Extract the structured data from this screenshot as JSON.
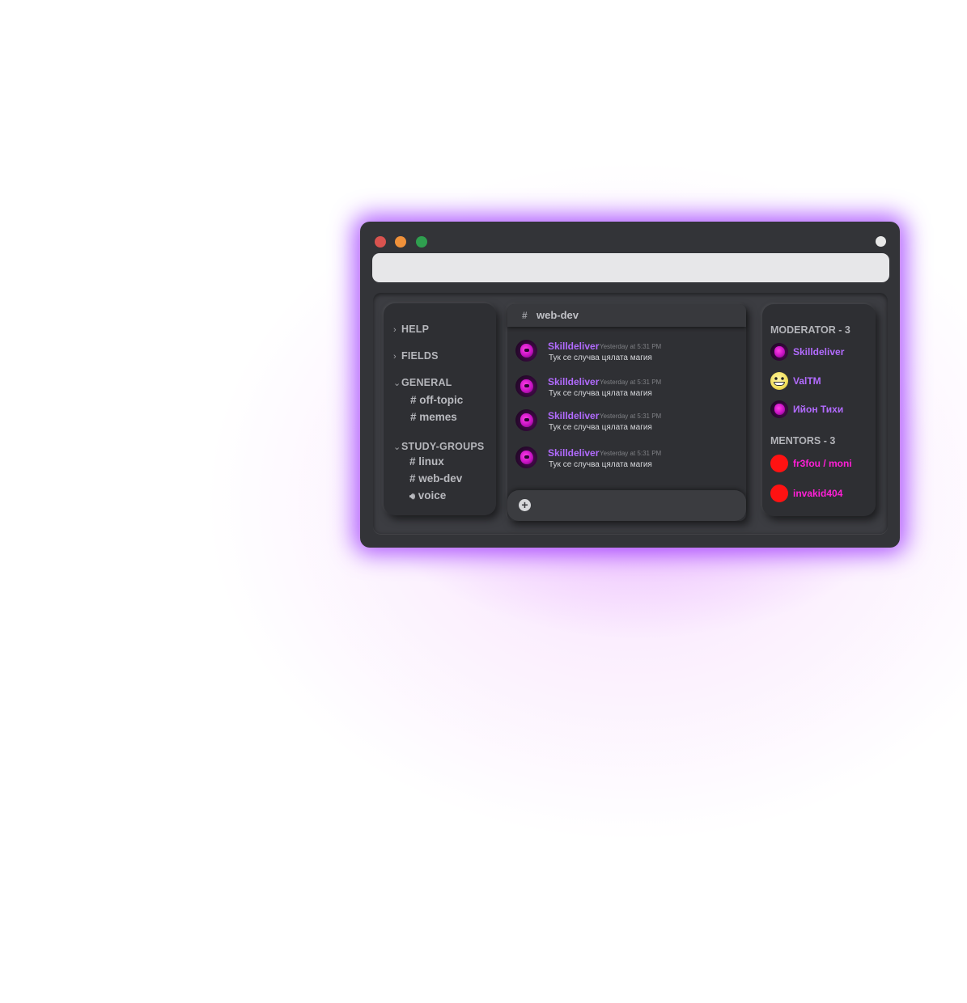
{
  "window": {
    "controls": [
      "close",
      "minimize",
      "maximize"
    ]
  },
  "address_bar": {
    "value": ""
  },
  "channels": {
    "categories": [
      {
        "label": "HELP",
        "expanded": false
      },
      {
        "label": "FIELDS",
        "expanded": false
      },
      {
        "label": "GENERAL",
        "expanded": true,
        "items": [
          "# off-topic",
          "# memes"
        ]
      },
      {
        "label": "STUDY-GROUPS",
        "expanded": true,
        "items": [
          "# linux",
          "# web-dev",
          "voice"
        ]
      }
    ]
  },
  "chat": {
    "hash": "#",
    "channel": "web-dev",
    "messages": [
      {
        "author": "Skilldeliver",
        "time": "Yesterday at 5:31 PM",
        "text": "Тук се случва цялата магия"
      },
      {
        "author": "Skilldeliver",
        "time": "Yesterday at 5:31 PM",
        "text": "Тук се случва цялата магия"
      },
      {
        "author": "Skilldeliver",
        "time": "Yesterday at 5:31 PM",
        "text": "Тук се случва цялата магия"
      },
      {
        "author": "Skilldeliver",
        "time": "Yesterday at 5:31 PM",
        "text": "Тук се случва цялата магия"
      }
    ],
    "composer": {
      "placeholder": "",
      "attach_icon": "plus-circle-icon"
    }
  },
  "members": {
    "moderators": {
      "title": "MODERATOR - 3",
      "list": [
        "Skilldeliver",
        "ValTM",
        "Ийон Тихи"
      ]
    },
    "mentors": {
      "title": "MENTORS - 3",
      "list": [
        "fr3fou / moni",
        "invakid404"
      ]
    }
  },
  "colors": {
    "accent_glow": "#9b2cff",
    "moderator_name": "#b26bff",
    "mentor_name": "#ff1fd6",
    "window_bg": "#333438",
    "close": "#d9534f",
    "minimize": "#f0913a",
    "maximize": "#2f9f4f"
  }
}
